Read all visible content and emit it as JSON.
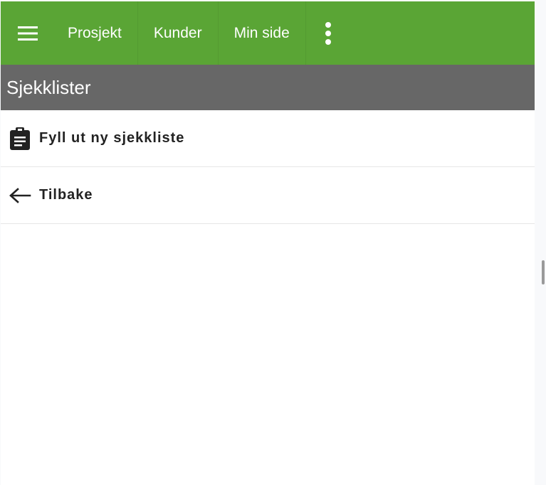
{
  "nav": {
    "items": [
      {
        "label": "Prosjekt"
      },
      {
        "label": "Kunder"
      },
      {
        "label": "Min side"
      }
    ]
  },
  "icons": {
    "menu": "hamburger-menu-icon",
    "more": "more-vertical-icon",
    "checklist": "clipboard-icon",
    "back": "arrow-left-icon"
  },
  "colors": {
    "topbar": "#5aa535",
    "subheader": "#676767",
    "text": "#222222"
  },
  "page": {
    "title": "Sjekklister"
  },
  "actions": [
    {
      "label": "Fyll ut ny sjekkliste"
    },
    {
      "label": "Tilbake"
    }
  ]
}
